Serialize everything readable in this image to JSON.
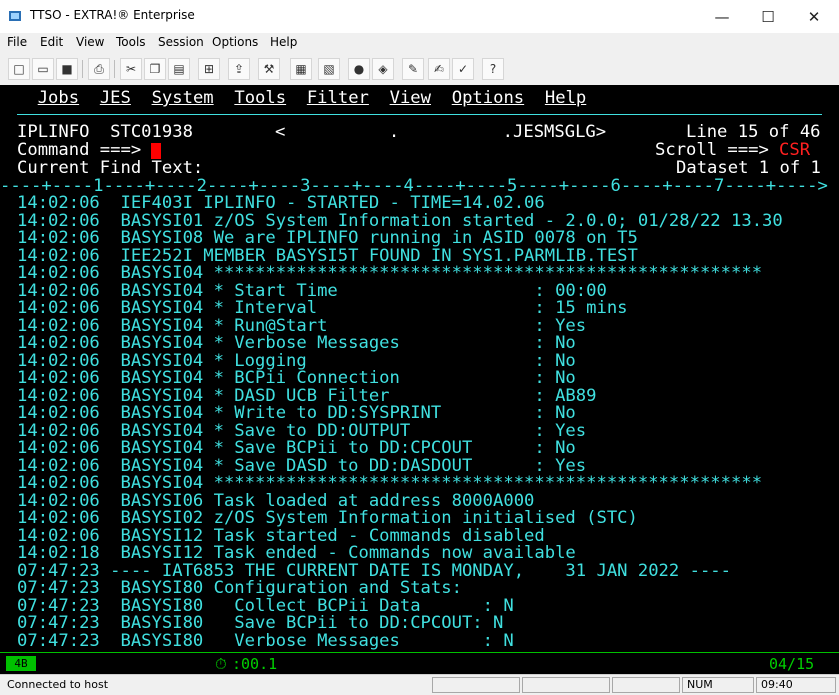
{
  "window": {
    "title": "TTSO - EXTRA!® Enterprise",
    "controls": {
      "minimize": "—",
      "maximize": "☐",
      "close": "✕"
    }
  },
  "menubar": {
    "items": [
      "File",
      "Edit",
      "View",
      "Tools",
      "Session",
      "Options",
      "Help"
    ]
  },
  "toolbar": {
    "buttons": [
      {
        "name": "new-icon",
        "glyph": "□"
      },
      {
        "name": "open-folder-icon",
        "glyph": "▭"
      },
      {
        "name": "save-icon",
        "glyph": "■"
      },
      {
        "name": "print-icon",
        "glyph": "⎙"
      },
      {
        "name": "cut-icon",
        "glyph": "✂"
      },
      {
        "name": "copy-icon",
        "glyph": "❐"
      },
      {
        "name": "paste-icon",
        "glyph": "▤"
      },
      {
        "name": "capture-icon",
        "glyph": "⊞"
      },
      {
        "name": "transfer-icon",
        "glyph": "⇪"
      },
      {
        "name": "settings-icon",
        "glyph": "⚒"
      },
      {
        "name": "quickpad-icon",
        "glyph": "▦"
      },
      {
        "name": "macro-icon",
        "glyph": "▧"
      },
      {
        "name": "record-icon",
        "glyph": "●"
      },
      {
        "name": "run-macro-icon",
        "glyph": "◈"
      },
      {
        "name": "edit-icon",
        "glyph": "✎"
      },
      {
        "name": "notes-icon",
        "glyph": "✍"
      },
      {
        "name": "check-icon",
        "glyph": "✓"
      },
      {
        "name": "help-icon",
        "glyph": "?"
      }
    ]
  },
  "terminal": {
    "menu": [
      "Jobs",
      "JES",
      "System",
      "Tools",
      "Filter",
      "View",
      "Options",
      "Help"
    ],
    "header": {
      "left": "IPLINFO  STC01938",
      "dataset": "<          .          .JESMSGLG>",
      "line_info": "Line 15 of 46"
    },
    "command": {
      "label": "Command ===>",
      "scroll_label": "Scroll ===>",
      "scroll_value": "CSR"
    },
    "find": {
      "label": "Current Find Text:",
      "dataset_info": "Dataset 1 of 1"
    },
    "ruler": "----+----1----+----2----+----3----+----4----+----5----+----6----+----7----+---->",
    "lines": [
      "14:02:06  IEF403I IPLINFO - STARTED - TIME=14.02.06",
      "14:02:06  BASYSI01 z/OS System Information started - 2.0.0; 01/28/22 13.30",
      "14:02:06  BASYSI08 We are IPLINFO running in ASID 0078 on T5",
      "14:02:06  IEE252I MEMBER BASYSI5T FOUND IN SYS1.PARMLIB.TEST",
      "14:02:06  BASYSI04 *****************************************************",
      "14:02:06  BASYSI04 * Start Time                   : 00:00",
      "14:02:06  BASYSI04 * Interval                     : 15 mins",
      "14:02:06  BASYSI04 * Run@Start                    : Yes",
      "14:02:06  BASYSI04 * Verbose Messages             : No",
      "14:02:06  BASYSI04 * Logging                      : No",
      "14:02:06  BASYSI04 * BCPii Connection             : No",
      "14:02:06  BASYSI04 * DASD UCB Filter              : AB89",
      "14:02:06  BASYSI04 * Write to DD:SYSPRINT         : No",
      "14:02:06  BASYSI04 * Save to DD:OUTPUT            : Yes",
      "14:02:06  BASYSI04 * Save BCPii to DD:CPCOUT      : No",
      "14:02:06  BASYSI04 * Save DASD to DD:DASDOUT      : Yes",
      "14:02:06  BASYSI04 *****************************************************",
      "14:02:06  BASYSI06 Task loaded at address 8000A000",
      "14:02:06  BASYSI02 z/OS System Information initialised (STC)",
      "14:02:06  BASYSI12 Task started - Commands disabled",
      "14:02:18  BASYSI12 Task ended - Commands now available",
      "07:47:23 ---- IAT6853 THE CURRENT DATE IS MONDAY,    31 JAN 2022 ----",
      "07:47:23  BASYSI80 Configuration and Stats:",
      "07:47:23  BASYSI80   Collect BCPii Data      : N",
      "07:47:23  BASYSI80   Save BCPii to DD:CPCOUT: N",
      "07:47:23  BASYSI80   Verbose Messages        : N"
    ]
  },
  "oia": {
    "session": "4B",
    "elapsed": ":00.1",
    "cursor_pos": "04/15"
  },
  "statusbar": {
    "connection": "Connected to host",
    "num": "NUM",
    "clock": "09:40"
  }
}
